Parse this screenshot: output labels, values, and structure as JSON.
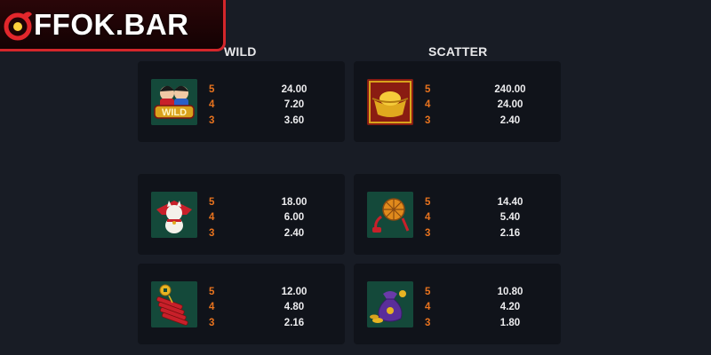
{
  "logo": {
    "text": "FFOK.BAR",
    "icon": "ok-hand-icon",
    "brand_color": "#d4262b"
  },
  "columns": {
    "left_title": "WILD",
    "right_title": "SCATTER"
  },
  "colors": {
    "count": "#e8731e",
    "value": "#ececee",
    "card_bg": "#10131a",
    "symbol_bg": "#14493a"
  },
  "paytable": [
    {
      "symbol": "wild-kids-icon",
      "rows": [
        {
          "count": "5",
          "value": "24.00"
        },
        {
          "count": "4",
          "value": "7.20"
        },
        {
          "count": "3",
          "value": "3.60"
        }
      ]
    },
    {
      "symbol": "gold-ingot-icon",
      "rows": [
        {
          "count": "5",
          "value": "240.00"
        },
        {
          "count": "4",
          "value": "24.00"
        },
        {
          "count": "3",
          "value": "2.40"
        }
      ]
    },
    {
      "symbol": "lucky-cat-icon",
      "rows": [
        {
          "count": "5",
          "value": "18.00"
        },
        {
          "count": "4",
          "value": "6.00"
        },
        {
          "count": "3",
          "value": "2.40"
        }
      ]
    },
    {
      "symbol": "firecracker-knot-icon",
      "rows": [
        {
          "count": "5",
          "value": "14.40"
        },
        {
          "count": "4",
          "value": "5.40"
        },
        {
          "count": "3",
          "value": "2.16"
        }
      ]
    },
    {
      "symbol": "firecrackers-coin-icon",
      "rows": [
        {
          "count": "5",
          "value": "12.00"
        },
        {
          "count": "4",
          "value": "4.80"
        },
        {
          "count": "3",
          "value": "2.16"
        }
      ]
    },
    {
      "symbol": "money-bag-icon",
      "rows": [
        {
          "count": "5",
          "value": "10.80"
        },
        {
          "count": "4",
          "value": "4.20"
        },
        {
          "count": "3",
          "value": "1.80"
        }
      ]
    }
  ]
}
